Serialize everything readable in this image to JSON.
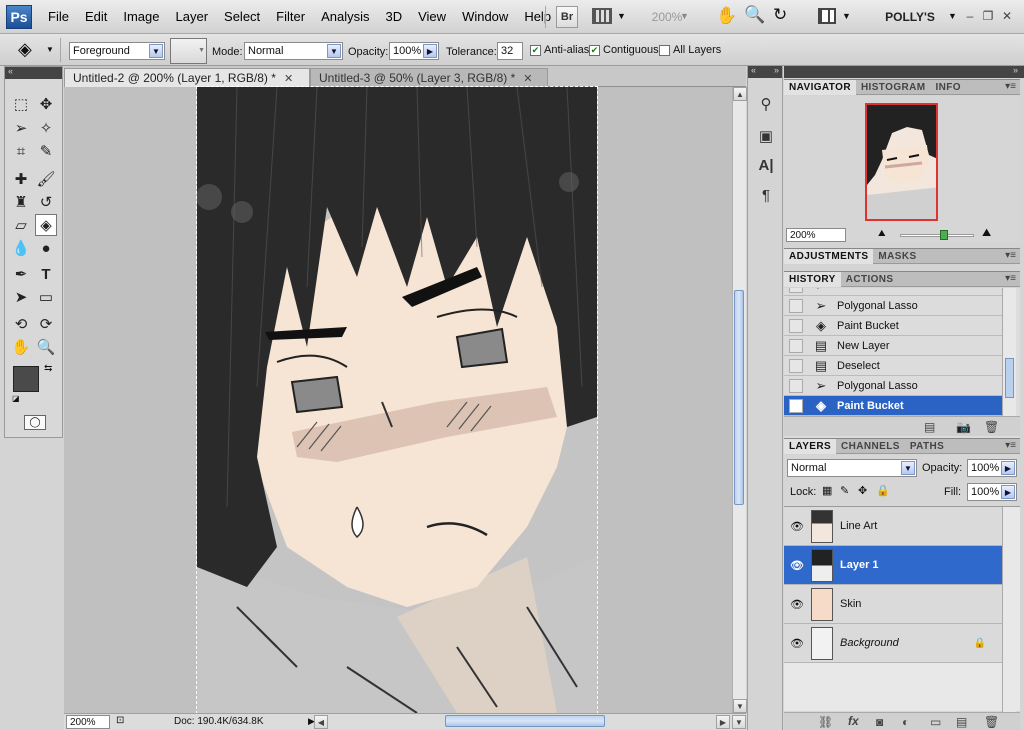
{
  "app": {
    "logo": "Ps",
    "workspace": "POLLY'S"
  },
  "menu": [
    "File",
    "Edit",
    "Image",
    "Layer",
    "Select",
    "Filter",
    "Analysis",
    "3D",
    "View",
    "Window",
    "Help"
  ],
  "toolbar": {
    "br_label": "Br",
    "zoom": "200%"
  },
  "options": {
    "fill_source": "Foreground",
    "mode_label": "Mode:",
    "mode_value": "Normal",
    "opacity_label": "Opacity:",
    "opacity_value": "100%",
    "tolerance_label": "Tolerance:",
    "tolerance_value": "32",
    "anti_alias_label": "Anti-alias",
    "contiguous_label": "Contiguous",
    "all_layers_label": "All Layers",
    "anti_alias_checked": true,
    "contiguous_checked": true,
    "all_layers_checked": false
  },
  "tabs": [
    {
      "label": "Untitled-2 @ 200% (Layer 1, RGB/8) *",
      "active": true
    },
    {
      "label": "Untitled-3 @ 50% (Layer 3, RGB/8) *",
      "active": false
    }
  ],
  "status": {
    "zoom": "200%",
    "doc": "Doc: 190.4K/634.8K"
  },
  "colors": {
    "foreground": "#4a4a4a",
    "background": "#fbeadb",
    "selection": "#2f69cc",
    "skin": "#f6e4d4"
  },
  "navigator": {
    "tabs": [
      "NAVIGATOR",
      "HISTOGRAM",
      "INFO"
    ],
    "zoom": "200%"
  },
  "adjustments": {
    "tabs": [
      "ADJUSTMENTS",
      "MASKS"
    ]
  },
  "history": {
    "tabs": [
      "HISTORY",
      "ACTIONS"
    ],
    "items": [
      {
        "label": "Polygonal Lasso",
        "icon": "lasso-icon"
      },
      {
        "label": "Paint Bucket",
        "icon": "bucket-icon"
      },
      {
        "label": "New Layer",
        "icon": "document-icon"
      },
      {
        "label": "Deselect",
        "icon": "document-icon"
      },
      {
        "label": "Polygonal Lasso",
        "icon": "lasso-icon"
      },
      {
        "label": "Paint Bucket",
        "icon": "bucket-icon",
        "selected": true
      }
    ]
  },
  "layers": {
    "tabs": [
      "LAYERS",
      "CHANNELS",
      "PATHS"
    ],
    "blend_mode": "Normal",
    "opacity_label": "Opacity:",
    "opacity_value": "100%",
    "lock_label": "Lock:",
    "fill_label": "Fill:",
    "fill_value": "100%",
    "items": [
      {
        "name": "Line Art",
        "visible": true
      },
      {
        "name": "Layer 1",
        "visible": true,
        "selected": true
      },
      {
        "name": "Skin",
        "visible": true
      },
      {
        "name": "Background",
        "visible": true,
        "locked": true,
        "italic": true
      }
    ]
  }
}
